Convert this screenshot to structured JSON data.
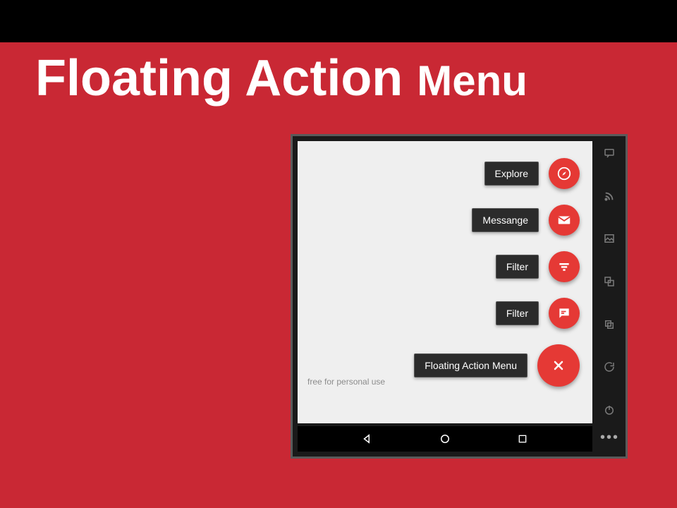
{
  "title": {
    "w1": "Floating",
    "w2": "Action",
    "w3": "Menu"
  },
  "fab": {
    "items": [
      {
        "label": "Explore",
        "icon": "compass-icon"
      },
      {
        "label": "Messange",
        "icon": "mail-icon"
      },
      {
        "label": "Filter",
        "icon": "filter-icon"
      },
      {
        "label": "Filter",
        "icon": "chat-icon"
      }
    ],
    "main": {
      "label": "Floating Action Menu",
      "icon": "close-icon"
    }
  },
  "sidebar_icons": [
    "sms-icon",
    "rss-icon",
    "picture-icon",
    "overlap-icon",
    "duplicate-icon",
    "rotate-icon",
    "power-icon"
  ],
  "nav": {
    "back": "back-icon",
    "home": "home-icon",
    "recents": "recents-icon"
  },
  "more": "•••",
  "watermark": "free for personal use",
  "colors": {
    "bg": "#c92834",
    "fab": "#e53935",
    "chip": "#2b2b2b"
  }
}
